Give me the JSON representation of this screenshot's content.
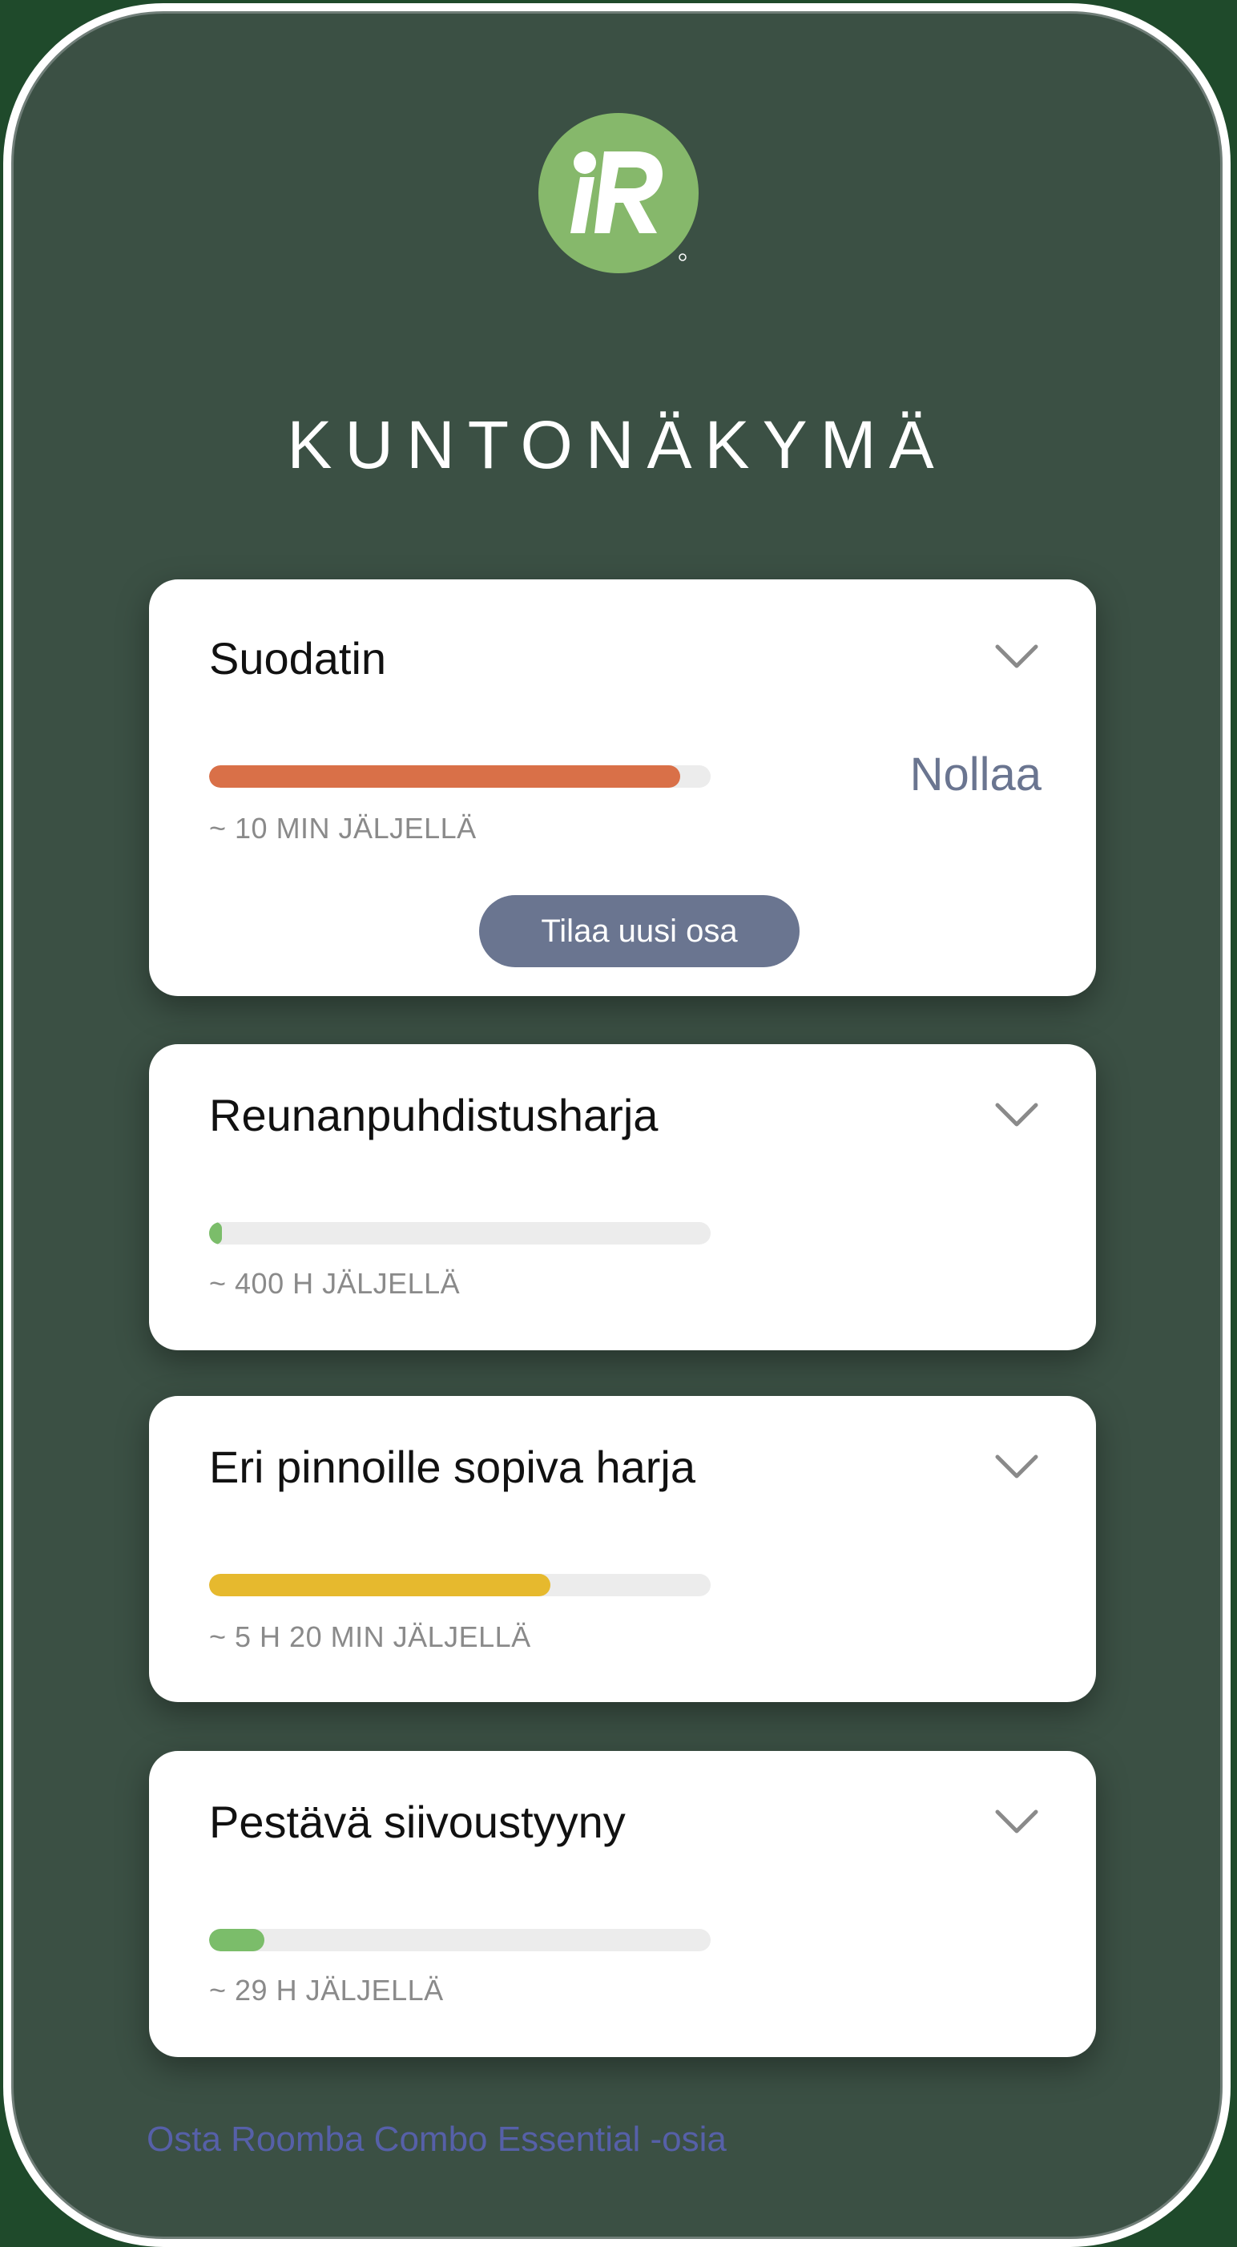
{
  "page": {
    "title": "KUNTONÄKYMÄ",
    "logo_text": "iR"
  },
  "cards": [
    {
      "title": "Suodatin",
      "remaining": "~ 10 MIN JÄLJELLÄ",
      "progress": 0.94,
      "bar_color": "#d97048",
      "reset_label": "Nollaa",
      "order_label": "Tilaa uusi osa"
    },
    {
      "title": "Reunanpuhdistusharja",
      "remaining": "~ 400 H JÄLJELLÄ",
      "progress": 0.025,
      "bar_color": "#7bbd6a"
    },
    {
      "title": "Eri pinnoille sopiva harja",
      "remaining": "~ 5 H 20 MIN JÄLJELLÄ",
      "progress": 0.68,
      "bar_color": "#e6b92e"
    },
    {
      "title": "Pestävä siivoustyyny",
      "remaining": "~ 29 H JÄLJELLÄ",
      "progress": 0.11,
      "bar_color": "#7bbd6a"
    }
  ],
  "footer": {
    "link_label": "Osta Roomba Combo Essential -osia"
  },
  "colors": {
    "background": "#3b5044",
    "accent": "#6a7590",
    "link": "#5660a8",
    "logo": "#86b86b"
  },
  "icons": {
    "logo": "irobot-logo-icon",
    "expand": "chevron-down-icon"
  }
}
